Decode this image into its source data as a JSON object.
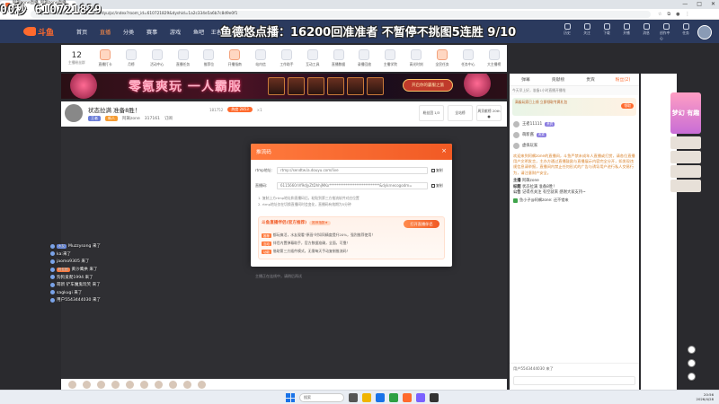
{
  "overlay": {
    "counter": "00秒 610721829",
    "promo": "鱼德悠点播：16200回准准者 不暂停不挑图5连胜 9/10"
  },
  "browser": {
    "active_tab": "阿飙zone直播_阿飙zone直播_阿",
    "new_tab": "+",
    "url": "https://www.douyu.com/6110586/dyu/pc/index?room_id=610721829&dyshid=1a2c334e5a6b7c8d9e0f1",
    "win_min": "—",
    "win_max": "□",
    "win_close": "✕"
  },
  "site": {
    "logo": "斗鱼",
    "nav": [
      "首页",
      "直播",
      "分类",
      "赛事",
      "游戏",
      "鱼吧",
      "王者荣耀"
    ],
    "header_icons": [
      "历史",
      "关注",
      "下载",
      "开播",
      "消息",
      "创作中心",
      "任务"
    ]
  },
  "categories": {
    "first_num": "12",
    "first_label": "主播粉丝群",
    "items": [
      "直播打卡",
      "月榜",
      "活动中心",
      "直播任务",
      "推荐位",
      "开播指南",
      "站内信",
      "工作助手",
      "互动工具",
      "直播数据",
      "录播回放",
      "主播学院",
      "高光时刻",
      "全民任务",
      "任务中心",
      "大主播榜",
      "更多"
    ]
  },
  "banner": {
    "text": "零氪爽玩 一人霸服",
    "cta": "开启你的霸服之旅"
  },
  "room": {
    "title": "状态拉满 准备8胜！",
    "tag_game": "王者",
    "tag_level": "新人",
    "name": "阿飙zone",
    "followers": "317161",
    "report": "订阅",
    "views": "181752",
    "hot_label": "热度",
    "hot_value": "2853",
    "hot_mult": "×1",
    "right_boxes": [
      "粉丝团 1/3",
      "全站榜",
      "周贡献榜 20th ●"
    ]
  },
  "danmu": [
    {
      "badge": "水友",
      "badge_color": "blue",
      "text": "Muzzysong 来了"
    },
    {
      "badge": "",
      "badge_color": "",
      "text": "ka:来了"
    },
    {
      "badge": "",
      "badge_color": "",
      "text": "jaomo9305 来了"
    },
    {
      "badge": "粉丝团",
      "badge_color": "orange",
      "text": "黄沙鹰拱 来了"
    },
    {
      "badge": "",
      "badge_color": "",
      "text": "狗狗爱爬1994 来了"
    },
    {
      "badge": "",
      "badge_color": "",
      "text": "萌新 铲车魔鬼玩笑 来了"
    },
    {
      "badge": "",
      "badge_color": "",
      "text": "sagkugi 来了"
    },
    {
      "badge": "",
      "badge_color": "",
      "text": "用户5543444030 来了"
    }
  ],
  "video": {
    "notice": "主播正在连线中，请稍后再试"
  },
  "modal": {
    "title": "推流码",
    "close": "×",
    "rtmp_label": "rtmp地址:",
    "rtmp_value": "rtmp://sendtw.la.douyu.com/live",
    "key_label": "直播码:",
    "key_value": "6115660rVf9dJyZtDhhjMKo****************************&dykrnecogodm=",
    "copy": "复制",
    "tips": [
      "1. 复制上方rtmp地址和直播码后，粘贴到第三方推流软件对应位置",
      "2. rtmp地址仅在切换直播间时会变化，直播码有效期为5分钟"
    ],
    "promo_title": "斗鱼直播伴侣(官方推荐)",
    "promo_pill": "推荐指数★",
    "promo_btn": "打开直播伴侣",
    "promo_lines": [
      {
        "k": "推荐",
        "t": "都玩搞活，水友观看\"原画\"时如同精度提升20%，强烈推荐使用！"
      },
      {
        "k": "互动",
        "t": "伴侣内置弹幕助手，官方数据准确，全面，可靠！"
      },
      {
        "k": "功能",
        "t": "借助第三方插件模式，无需每天手动复制推流码！"
      }
    ]
  },
  "rpanel": {
    "tabs": [
      "弹幕",
      "贡献榜",
      "贵宾",
      "粉丝(2)"
    ],
    "tip": "今天早上好，准备1小时直播开播啦",
    "card": "高级玩家已上线 立即领取专属礼包",
    "card_btn": "领取",
    "users": [
      {
        "name": "王者11111",
        "badge": "贵宾"
      },
      {
        "name": "萌新酱",
        "badge": "贵宾"
      },
      {
        "name": "虚拟玩家",
        "badge": ""
      }
    ],
    "welcome": "欢迎来到阿飙zone的直播间，斗鱼严禁未成年人直播或打赏，请各位直播用户文明发言，主办方通过直播鼓励与直播展示内容完全分开，如发现违规信息请举报，直播间内禁止任何形式的广告与诱导用户进行私人交易行为，请注意财产安全。",
    "lines": [
      {
        "k": "主播",
        "t": "阿飙zone"
      },
      {
        "k": "标题",
        "t": "状态拉满 准备8胜！"
      },
      {
        "k": "公告",
        "t": "记得点关注 有空就来 感谢大家支持~"
      }
    ],
    "note": "鱼小子@阿飙zone: 还不错来",
    "bottom_text": "用户5543444030 来了"
  },
  "ad": {
    "text": "梦幻 有趣"
  },
  "taskbar": {
    "search": "搜索",
    "time": "20:56",
    "date": "2026/4/28"
  }
}
